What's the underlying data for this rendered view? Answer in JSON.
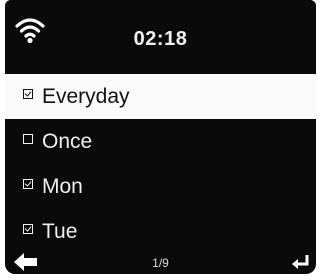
{
  "header": {
    "time": "02:18",
    "wifi_icon": "wifi-icon"
  },
  "menu": {
    "items": [
      {
        "label": "Everyday",
        "checked": true,
        "selected": true
      },
      {
        "label": "Once",
        "checked": false,
        "selected": false
      },
      {
        "label": "Mon",
        "checked": true,
        "selected": false
      },
      {
        "label": "Tue",
        "checked": true,
        "selected": false
      }
    ]
  },
  "footer": {
    "page": "1/9",
    "back_icon": "back-arrow-icon",
    "enter_icon": "enter-icon"
  },
  "colors": {
    "screen_background": "#0a0a0a",
    "selected_row": "#fafafa",
    "text": "#efefef"
  }
}
